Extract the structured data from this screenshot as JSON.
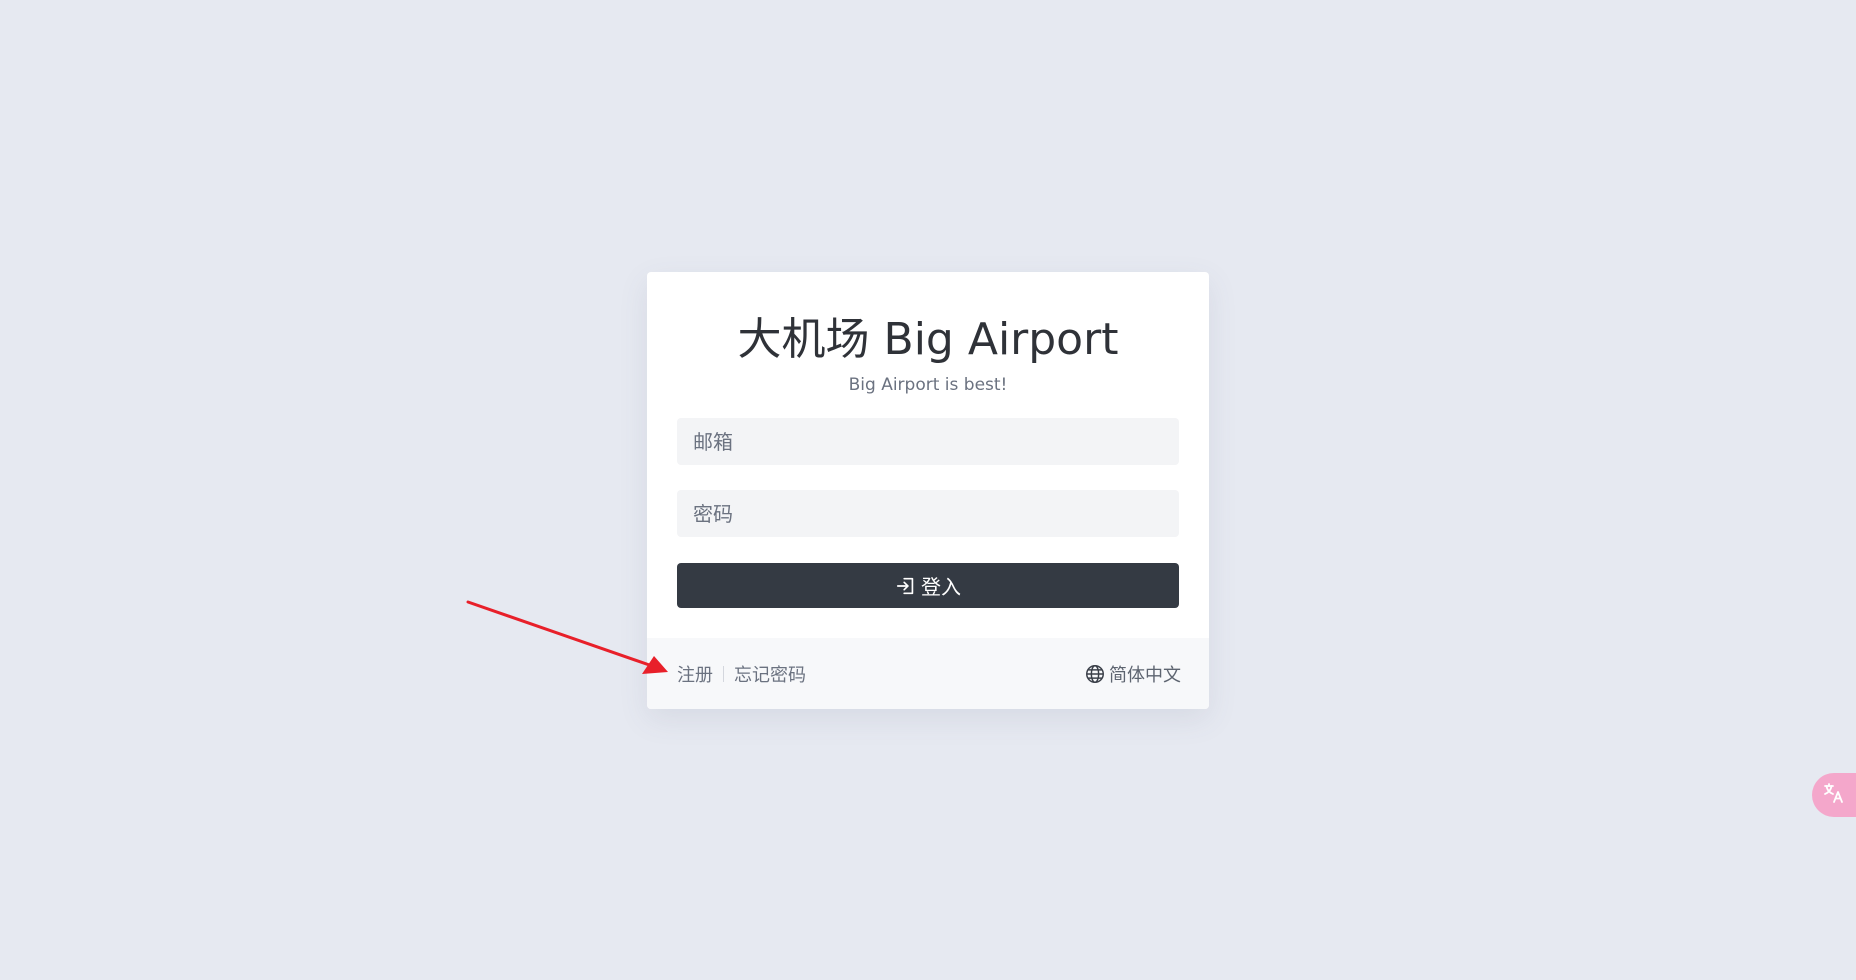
{
  "card": {
    "title": "大机场 Big Airport",
    "subtitle": "Big Airport is best!"
  },
  "form": {
    "email_placeholder": "邮箱",
    "password_placeholder": "密码",
    "login_label": "登入",
    "login_icon": "sign-in-icon"
  },
  "footer": {
    "register_label": "注册",
    "forgot_label": "忘记密码",
    "language_label": "简体中文",
    "language_icon": "globe-icon"
  },
  "annotation": {
    "arrow_color": "#e8202a"
  },
  "floating": {
    "translate_icon": "translate-icon",
    "translate_color": "#f4a7cb"
  }
}
